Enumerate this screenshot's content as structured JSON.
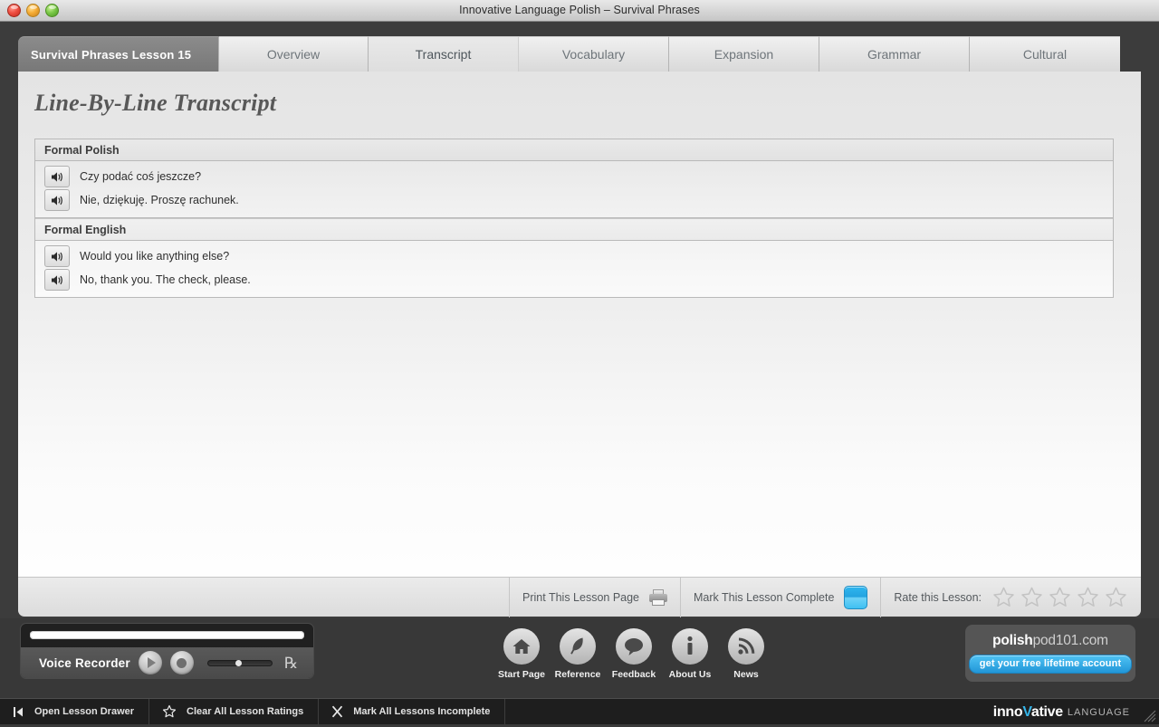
{
  "window": {
    "title": "Innovative Language Polish – Survival Phrases",
    "controls": [
      "close-button",
      "minimize-button",
      "zoom-button"
    ]
  },
  "tabs": [
    {
      "label": "Survival Phrases Lesson 15",
      "kind": "lesson-label",
      "active": false
    },
    {
      "label": "Overview",
      "kind": "tab",
      "active": false
    },
    {
      "label": "Transcript",
      "kind": "tab",
      "active": true
    },
    {
      "label": "Vocabulary",
      "kind": "tab",
      "active": false
    },
    {
      "label": "Expansion",
      "kind": "tab",
      "active": false
    },
    {
      "label": "Grammar",
      "kind": "tab",
      "active": false
    },
    {
      "label": "Cultural",
      "kind": "tab",
      "active": false
    }
  ],
  "page": {
    "title": "Line-By-Line Transcript"
  },
  "transcript": {
    "sections": [
      {
        "heading": "Formal Polish",
        "lines": [
          {
            "audio_icon": "speaker-icon",
            "text": "Czy podać coś jeszcze?"
          },
          {
            "audio_icon": "speaker-icon",
            "text": "Nie, dziękuję. Proszę rachunek."
          }
        ]
      },
      {
        "heading": "Formal English",
        "lines": [
          {
            "audio_icon": "speaker-icon",
            "text": "Would you like anything else?"
          },
          {
            "audio_icon": "speaker-icon",
            "text": "No, thank you. The check, please."
          }
        ]
      }
    ]
  },
  "lesson_footer": {
    "print_label": "Print This Lesson Page",
    "print_icon": "printer-icon",
    "complete_label": "Mark This Lesson Complete",
    "complete_icon": "checkbox-blue",
    "rate_label": "Rate this Lesson:",
    "stars_total": 5,
    "stars_filled": 0
  },
  "recorder": {
    "label": "Voice Recorder",
    "play_icon": "play-icon",
    "record_icon": "record-icon",
    "volume_icon": "sound-wave-icon",
    "volume_value": 45,
    "progress_value": 100
  },
  "nav_icons": [
    {
      "label": "Start Page",
      "icon": "home-icon"
    },
    {
      "label": "Reference",
      "icon": "feather-icon"
    },
    {
      "label": "Feedback",
      "icon": "speech-bubble-icon"
    },
    {
      "label": "About Us",
      "icon": "info-icon"
    },
    {
      "label": "News",
      "icon": "rss-icon"
    }
  ],
  "promo": {
    "url_bold": "polish",
    "url_rest": "pod101.com",
    "button_label": "get your free lifetime account"
  },
  "statusbar": {
    "items": [
      {
        "label": "Open Lesson Drawer",
        "icon": "drawer-open-icon"
      },
      {
        "label": "Clear All Lesson Ratings",
        "icon": "star-outline-icon"
      },
      {
        "label": "Mark All Lessons Incomplete",
        "icon": "x-mark-icon"
      }
    ],
    "brand_main": "inno",
    "brand_v": "V",
    "brand_main2": "ative",
    "brand_sub": "LANGUAGE"
  },
  "colors": {
    "accent_blue": "#35b4e8",
    "complete_blue": "#2fb7ef",
    "dark_chrome": "#3c3c3c",
    "statusbar": "#1e1e1e"
  }
}
